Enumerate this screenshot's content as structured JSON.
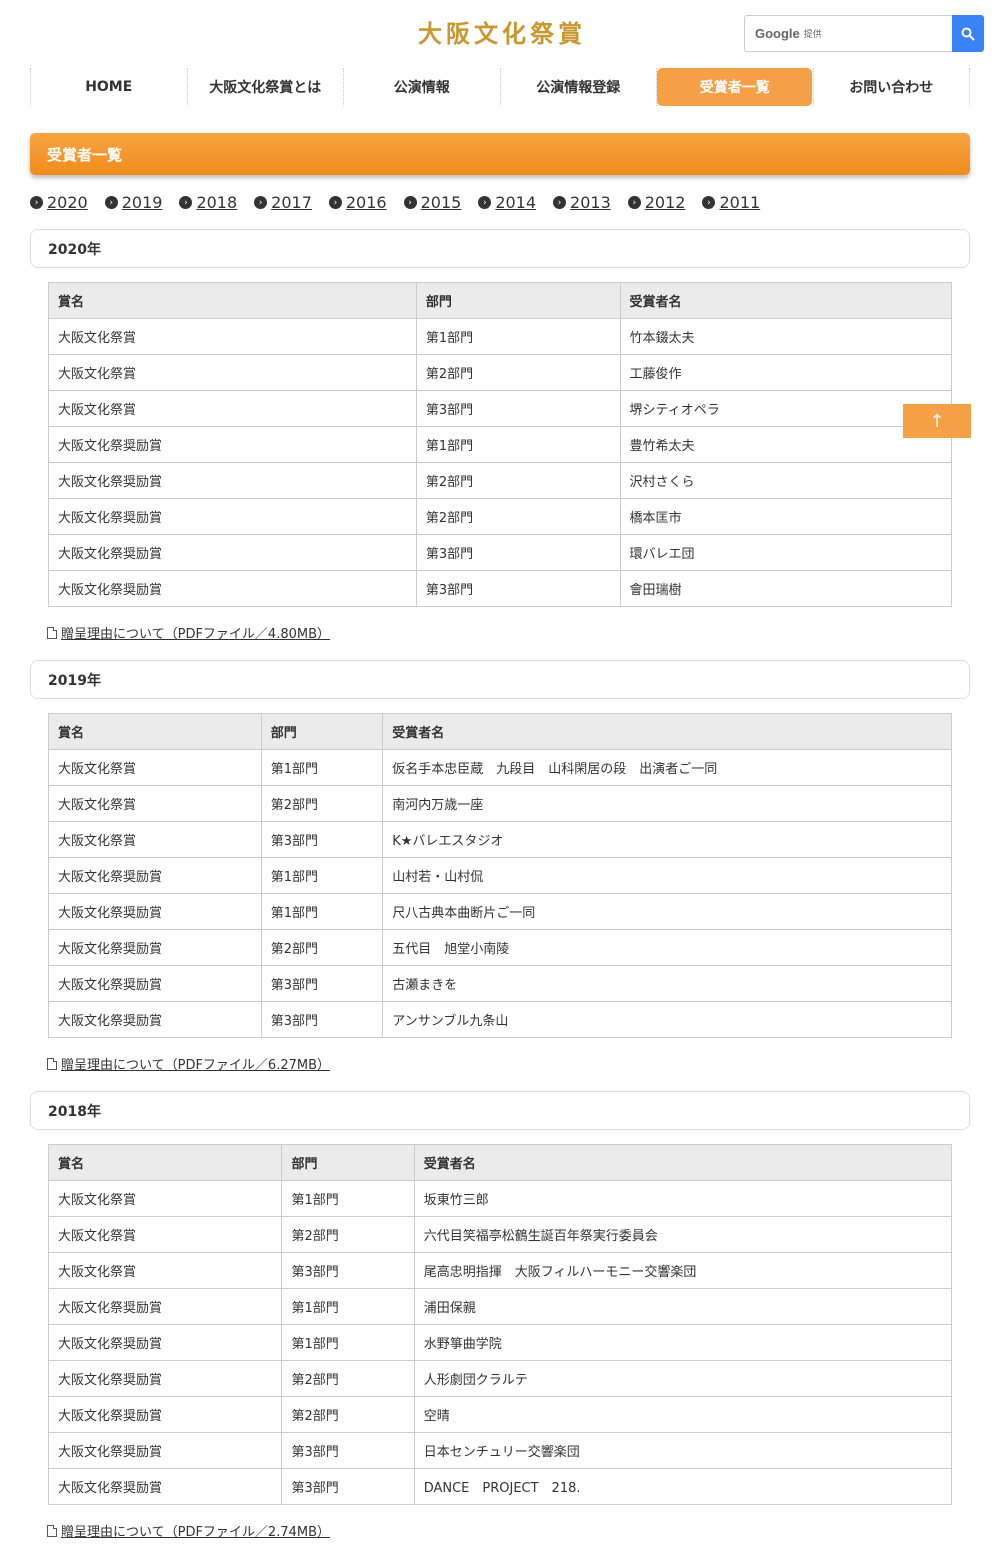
{
  "site": {
    "logo": "大阪文化祭賞"
  },
  "search": {
    "google": "Google",
    "provided": "提供"
  },
  "nav": [
    "HOME",
    "大阪文化祭賞とは",
    "公演情報",
    "公演情報登録",
    "受賞者一覧",
    "お問い合わせ"
  ],
  "page_title": "受賞者一覧",
  "year_links": [
    "2020",
    "2019",
    "2018",
    "2017",
    "2016",
    "2015",
    "2014",
    "2013",
    "2012",
    "2011"
  ],
  "col_headers": [
    "賞名",
    "部門",
    "受賞者名"
  ],
  "sections": [
    {
      "title": "2020年",
      "rows": [
        [
          "大阪文化祭賞",
          "第1部門",
          "竹本錣太夫"
        ],
        [
          "大阪文化祭賞",
          "第2部門",
          "工藤俊作"
        ],
        [
          "大阪文化祭賞",
          "第3部門",
          "堺シティオペラ"
        ],
        [
          "大阪文化祭奨励賞",
          "第1部門",
          "豊竹希太夫"
        ],
        [
          "大阪文化祭奨励賞",
          "第2部門",
          "沢村さくら"
        ],
        [
          "大阪文化祭奨励賞",
          "第2部門",
          "橋本匡市"
        ],
        [
          "大阪文化祭奨励賞",
          "第3部門",
          "環バレエ団"
        ],
        [
          "大阪文化祭奨励賞",
          "第3部門",
          "會田瑞樹"
        ]
      ],
      "pdf": "贈呈理由について（PDFファイル／4.80MB）"
    },
    {
      "title": "2019年",
      "rows": [
        [
          "大阪文化祭賞",
          "第1部門",
          "仮名手本忠臣蔵　九段目　山科閑居の段　出演者ご一同"
        ],
        [
          "大阪文化祭賞",
          "第2部門",
          "南河内万歳一座"
        ],
        [
          "大阪文化祭賞",
          "第3部門",
          "K★バレエスタジオ"
        ],
        [
          "大阪文化祭奨励賞",
          "第1部門",
          "山村若・山村侃"
        ],
        [
          "大阪文化祭奨励賞",
          "第1部門",
          "尺八古典本曲断片ご一同"
        ],
        [
          "大阪文化祭奨励賞",
          "第2部門",
          "五代目　旭堂小南陵"
        ],
        [
          "大阪文化祭奨励賞",
          "第3部門",
          "古瀬まきを"
        ],
        [
          "大阪文化祭奨励賞",
          "第3部門",
          "アンサンブル九条山"
        ]
      ],
      "pdf": "贈呈理由について（PDFファイル／6.27MB）"
    },
    {
      "title": "2018年",
      "rows": [
        [
          "大阪文化祭賞",
          "第1部門",
          "坂東竹三郎"
        ],
        [
          "大阪文化祭賞",
          "第2部門",
          "六代目笑福亭松鶴生誕百年祭実行委員会"
        ],
        [
          "大阪文化祭賞",
          "第3部門",
          "尾高忠明指揮　大阪フィルハーモニー交響楽団"
        ],
        [
          "大阪文化祭奨励賞",
          "第1部門",
          "浦田保親"
        ],
        [
          "大阪文化祭奨励賞",
          "第1部門",
          "水野箏曲学院"
        ],
        [
          "大阪文化祭奨励賞",
          "第2部門",
          "人形劇団クラルテ"
        ],
        [
          "大阪文化祭奨励賞",
          "第2部門",
          "空晴"
        ],
        [
          "大阪文化祭奨励賞",
          "第3部門",
          "日本センチュリー交響楽団"
        ],
        [
          "大阪文化祭奨励賞",
          "第3部門",
          "DANCE　PROJECT　218."
        ]
      ],
      "pdf": "贈呈理由について（PDFファイル／2.74MB）"
    }
  ],
  "colors": {
    "accent": "#f5a046",
    "logo": "#c9972e",
    "search_button": "#3b82f6"
  },
  "icons": {
    "search": "search-icon",
    "to_top": "arrow-up-icon",
    "pdf": "pdf-file-icon",
    "year": "chevron-circle-right-icon"
  },
  "to_top_label": "↑"
}
